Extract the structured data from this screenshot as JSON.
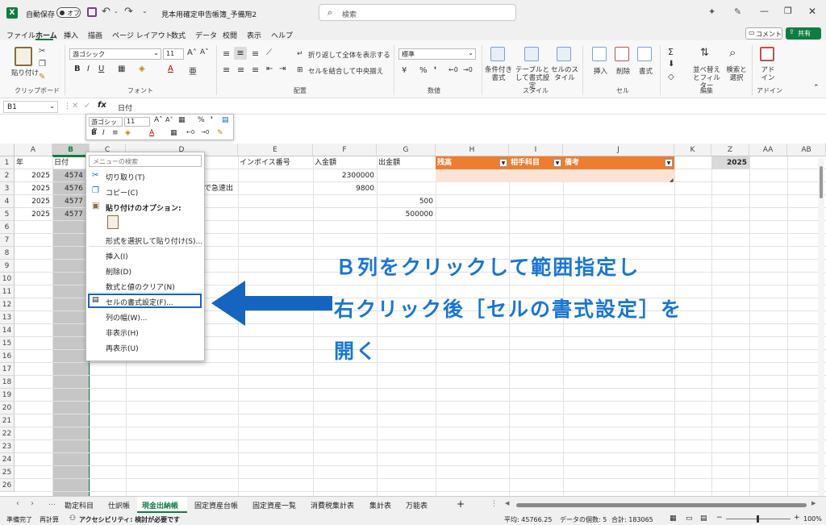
{
  "titlebar": {
    "autosave_label": "自動保存",
    "autosave_state": "オフ",
    "filename": "見本用確定申告帳簿_予備用2",
    "search_placeholder": "検索"
  },
  "menubar": {
    "tabs": [
      "ファイル",
      "ホーム",
      "挿入",
      "描画",
      "ページ レイアウト",
      "数式",
      "データ",
      "校閲",
      "表示",
      "ヘルプ"
    ],
    "active_tab": "ホーム",
    "comment_label": "コメント",
    "share_label": "共有"
  },
  "ribbon": {
    "groups": [
      "クリップボード",
      "フォント",
      "配置",
      "数値",
      "スタイル",
      "セル",
      "編集",
      "アドイン"
    ],
    "paste_label": "貼り付け",
    "font_name": "游ゴシック",
    "font_size": "11",
    "wrap_label": "折り返して全体を表示する",
    "merge_label": "セルを結合して中央揃え",
    "number_format": "標準",
    "style_buttons": [
      "条件付き書式",
      "テーブルとして書式設定",
      "セルのスタイル"
    ],
    "cell_buttons": [
      "挿入",
      "削除",
      "書式"
    ],
    "edit_buttons": [
      "並べ替えとフィルター",
      "検索と選択"
    ],
    "addin_label": "アドイン"
  },
  "formulabar": {
    "namebox": "B1",
    "fx": "fx",
    "content": "日付"
  },
  "mini_toolbar": {
    "font_name": "游ゴシック",
    "font_size": "11"
  },
  "columns": [
    "A",
    "B",
    "C",
    "D",
    "E",
    "F",
    "G",
    "H",
    "I",
    "J",
    "K",
    "Z",
    "AA",
    "AB"
  ],
  "rows": [
    "1",
    "2",
    "3",
    "4",
    "5",
    "6",
    "7",
    "8",
    "9",
    "10",
    "11",
    "12",
    "13",
    "14",
    "15",
    "16",
    "17",
    "18",
    "19",
    "20",
    "21",
    "22",
    "23",
    "24",
    "25",
    "26"
  ],
  "cells": {
    "A1": "年",
    "B1": "日付",
    "A2": "2025",
    "A3": "2025",
    "A4": "2025",
    "A5": "2025",
    "B2": "4574",
    "B3": "4576",
    "B4": "4577",
    "B5": "4577",
    "E1": "インボイス番号",
    "F1": "入金額",
    "G1": "出金額",
    "D3": "で急速出",
    "F2": "2300000",
    "F3": "9800",
    "G4": "500",
    "G5": "500000",
    "H1": "残高",
    "I1": "相手科目",
    "J1": "備考",
    "Z1": "2025"
  },
  "context_menu": {
    "search_placeholder": "メニューの検索",
    "items": [
      "切り取り(T)",
      "コピー(C)",
      "貼り付けのオプション:",
      "形式を選択して貼り付け(S)...",
      "挿入(I)",
      "削除(D)",
      "数式と値のクリア(N)",
      "セルの書式設定(F)...",
      "列の幅(W)...",
      "非表示(H)",
      "再表示(U)"
    ]
  },
  "annotation": {
    "line1": "Ｂ列をクリックして範囲指定し",
    "line2": "右クリック後［セルの書式設定］を",
    "line3": "開く",
    "color": "#1a76d2"
  },
  "sheet_tabs": {
    "tabs": [
      "勘定科目",
      "仕訳帳",
      "現金出納帳",
      "固定資産台帳",
      "固定資産一覧",
      "消費税集計表",
      "集計表",
      "万能表"
    ],
    "active": "現金出納帳",
    "add_label": "+"
  },
  "statusbar": {
    "ready": "準備完了",
    "recalc": "再計算",
    "accessibility": "アクセシビリティ: 検討が必要です",
    "average": "平均: 45766.25",
    "count": "データの個数: 5",
    "sum": "合計: 183065",
    "zoom": "100%"
  },
  "colors": {
    "excel_green": "#107c41",
    "accent_orange": "#ed7d31",
    "highlight_blue": "#1565c0"
  }
}
